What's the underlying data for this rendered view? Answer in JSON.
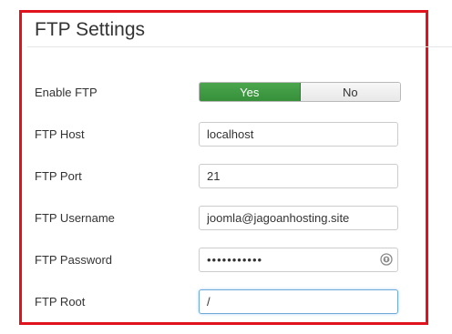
{
  "section": {
    "title": "FTP Settings"
  },
  "colors": {
    "highlight": "#e0121e",
    "toggle_on": "#3d9a40"
  },
  "fields": {
    "enable_ftp": {
      "label": "Enable FTP",
      "yes_label": "Yes",
      "no_label": "No",
      "selected": "Yes"
    },
    "host": {
      "label": "FTP Host",
      "value": "localhost"
    },
    "port": {
      "label": "FTP Port",
      "value": "21"
    },
    "username": {
      "label": "FTP Username",
      "value": "joomla@jagoanhosting.site"
    },
    "password": {
      "label": "FTP Password",
      "value": "•••••••••••",
      "icon": "password-reveal-icon"
    },
    "root": {
      "label": "FTP Root",
      "value": "/"
    }
  }
}
